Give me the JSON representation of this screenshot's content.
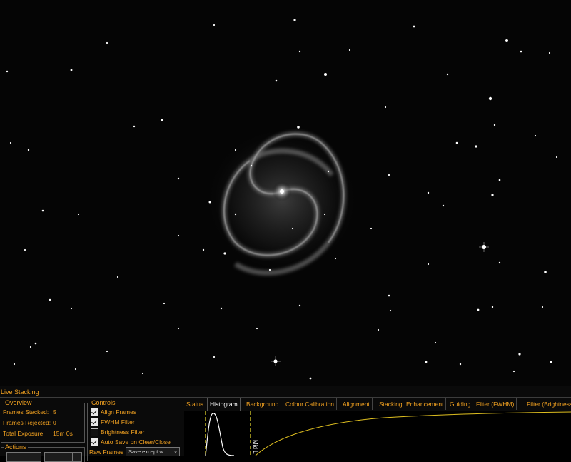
{
  "image": {
    "subject": "spiral-galaxy"
  },
  "panel": {
    "title": "Live Stacking",
    "overview": {
      "title": "Overview",
      "rows": [
        {
          "label": "Frames Stacked:",
          "value": "5"
        },
        {
          "label": "Frames Rejected:",
          "value": "0"
        },
        {
          "label": "Total Exposure:",
          "value": "15m 0s"
        }
      ]
    },
    "actions": {
      "title": "Actions"
    },
    "controls": {
      "title": "Controls",
      "checkboxes": [
        {
          "label": "Align Frames",
          "checked": true
        },
        {
          "label": "FWHM Filter",
          "checked": true
        },
        {
          "label": "Brightness Filter",
          "checked": false
        },
        {
          "label": "Auto Save on Clear/Close",
          "checked": true
        }
      ],
      "raw_frames_label": "Raw Frames",
      "raw_frames_value": "Save except w"
    },
    "tabs": [
      {
        "label": "Status",
        "active": false
      },
      {
        "label": "Histogram",
        "active": true
      },
      {
        "label": "Background",
        "active": false
      },
      {
        "label": "Colour Calibration",
        "active": false
      },
      {
        "label": "Alignment",
        "active": false
      },
      {
        "label": "Stacking",
        "active": false
      },
      {
        "label": "Enhancement",
        "active": false
      },
      {
        "label": "Guiding",
        "active": false
      },
      {
        "label": "Filter (FWHM)",
        "active": false
      },
      {
        "label": "Filter (Brightness)",
        "active": false
      }
    ],
    "histogram": {
      "mid_label": "Mid L"
    }
  },
  "colors": {
    "accent": "#f0a020",
    "curve": "#e0c020",
    "marker": "#f0e030"
  }
}
